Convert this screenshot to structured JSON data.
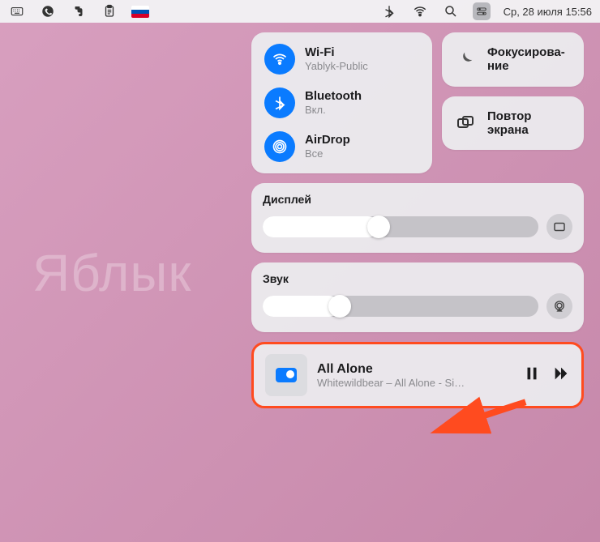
{
  "menubar": {
    "datetime": "Ср, 28 июля  15:56"
  },
  "connectivity": {
    "wifi": {
      "title": "Wi-Fi",
      "subtitle": "Yablyk-Public"
    },
    "bluetooth": {
      "title": "Bluetooth",
      "subtitle": "Вкл."
    },
    "airdrop": {
      "title": "AirDrop",
      "subtitle": "Все"
    }
  },
  "focus": {
    "label": "Фокусирова-\nние"
  },
  "screen_mirroring": {
    "label": "Повтор\nэкрана"
  },
  "display": {
    "label": "Дисплей",
    "value_pct": 42
  },
  "sound": {
    "label": "Звук",
    "value_pct": 28
  },
  "now_playing": {
    "title": "All Alone",
    "subtitle": "Whitewildbear – All Alone - Si…"
  },
  "watermark": "Яблык"
}
